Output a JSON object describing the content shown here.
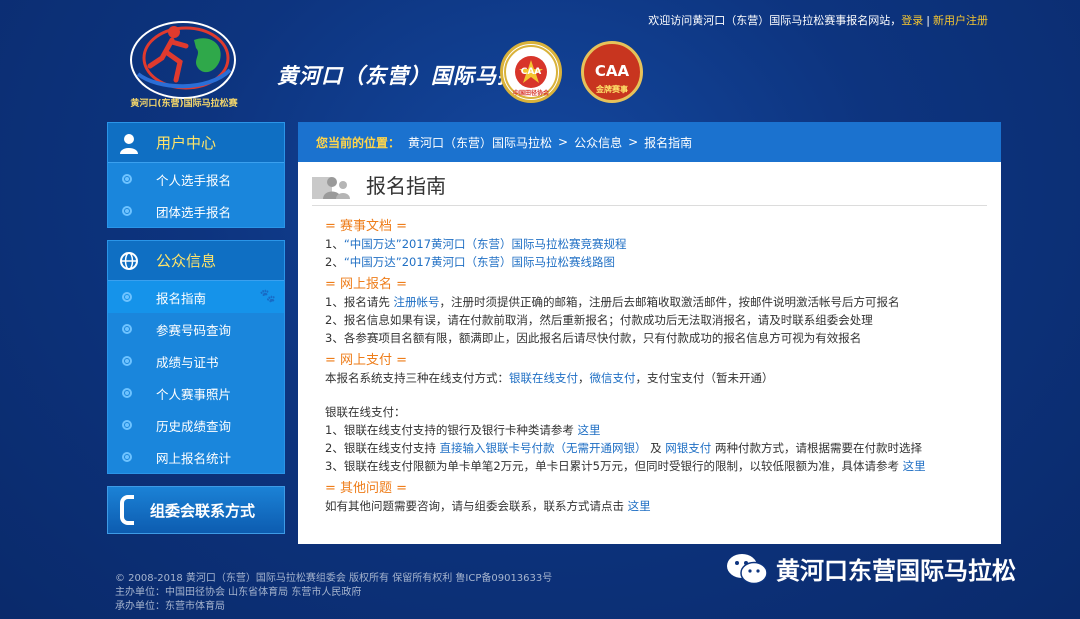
{
  "topbar": {
    "welcome": "欢迎访问黄河口（东营）国际马拉松赛事报名网站，",
    "login": "登录",
    "separator": "|",
    "register": "新用户注册"
  },
  "brand": {
    "title": "黄河口（东营）国际马拉松",
    "logo_caption": "黄河口(东营)国际马拉松赛",
    "seal_caa_text": "中国田径协会",
    "seal_caa_mark": "CAA",
    "seal_gold_text": "金牌赛事",
    "seal_gold_mark": "CAA"
  },
  "sidebar": {
    "user_center": {
      "title": "用户中心",
      "items": [
        {
          "label": "个人选手报名"
        },
        {
          "label": "团体选手报名"
        }
      ]
    },
    "public_info": {
      "title": "公众信息",
      "items": [
        {
          "label": "报名指南",
          "active": true
        },
        {
          "label": "参赛号码查询"
        },
        {
          "label": "成绩与证书"
        },
        {
          "label": "个人赛事照片"
        },
        {
          "label": "历史成绩查询"
        },
        {
          "label": "网上报名统计"
        }
      ]
    },
    "contact_banner": "组委会联系方式"
  },
  "breadcrumb": {
    "label": "您当前的位置：",
    "items": [
      "黄河口（东营）国际马拉松",
      "公众信息",
      "报名指南"
    ],
    "separator": ">"
  },
  "page": {
    "title": "报名指南"
  },
  "content": {
    "docs_heading": "= 赛事文档 =",
    "docs": [
      {
        "prefix": "1、",
        "link": "“中国万达”2017黄河口（东营）国际马拉松赛竞赛规程"
      },
      {
        "prefix": "2、",
        "link": "“中国万达”2017黄河口（东营）国际马拉松赛线路图"
      }
    ],
    "online_heading": "= 网上报名 =",
    "online_1_a": "1、报名请先 ",
    "online_1_link": "注册帐号",
    "online_1_b": "，注册时须提供正确的邮箱，注册后去邮箱收取激活邮件，按邮件说明激活帐号后方可报名",
    "online_2": "2、报名信息如果有误，请在付款前取消，然后重新报名；付款成功后无法取消报名，请及时联系组委会处理",
    "online_3": "3、各参赛项目名额有限，额满即止，因此报名后请尽快付款，只有付款成功的报名信息方可视为有效报名",
    "pay_heading": "= 网上支付 =",
    "pay_intro_a": "本报名系统支持三种在线支付方式：",
    "pay_intro_link1": "银联在线支付",
    "pay_intro_b": "，",
    "pay_intro_link2": "微信支付",
    "pay_intro_c": "，支付宝支付（暂未开通）",
    "unionpay_title": "银联在线支付：",
    "up_1_a": "1、银联在线支付支持的银行及银行卡种类请参考 ",
    "up_1_link": "这里",
    "up_2_a": "2、银联在线支付支持 ",
    "up_2_link1": "直接输入银联卡号付款（无需开通网银）",
    "up_2_b": " 及 ",
    "up_2_link2": "网银支付",
    "up_2_c": " 两种付款方式，请根据需要在付款时选择",
    "up_3_a": "3、银联在线支付限额为单卡单笔2万元，单卡日累计5万元，但同时受银行的限制，以较低限额为准，具体请参考 ",
    "up_3_link": "这里",
    "other_heading": "= 其他问题 =",
    "other_a": "如有其他问题需要咨询，请与组委会联系，联系方式请点击 ",
    "other_link": "这里"
  },
  "footer": {
    "line1": "© 2008-2018 黄河口（东营）国际马拉松赛组委会 版权所有 保留所有权利 鲁ICP备09013633号",
    "line2": "主办单位：中国田径协会 山东省体育局 东营市人民政府",
    "line3": "承办单位：东营市体育局"
  },
  "watermark": {
    "text": "黄河口东营国际马拉松"
  },
  "colors": {
    "background": "#0d347f",
    "accent_orange": "#ee7d1a",
    "link_blue": "#1f6fc4",
    "sidebar_blue": "#1a86dc",
    "header_yellow": "#ffe46a"
  }
}
